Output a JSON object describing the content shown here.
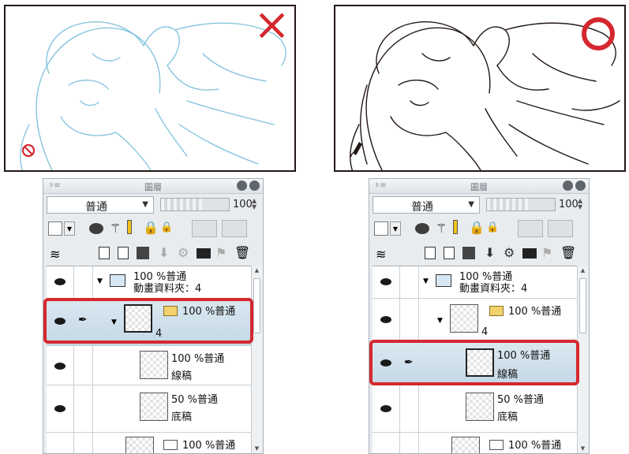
{
  "canvases": [
    {
      "marker": "×",
      "marker_name": "cross",
      "stroke_color": "#7fc2dc",
      "cursor": "prohibited-icon"
    },
    {
      "marker": "○",
      "marker_name": "circle",
      "stroke_color": "#231815",
      "cursor": "pen-icon"
    }
  ],
  "marker_color": "#d4282e",
  "panels": [
    {
      "title": "圖層",
      "blend_mode": "普通",
      "opacity": "100",
      "opacity_fill": 0.6,
      "layers": [
        {
          "line1": "100 %普通",
          "line2": "動畫資料夾：4"
        },
        {
          "line1": "100 %普通",
          "line2": "4"
        },
        {
          "line1": "100 %普通",
          "line2": "線稿"
        },
        {
          "line1": "50 %普通",
          "line2": "底稿"
        },
        {
          "line1": "100 %普通",
          "line2": ""
        }
      ]
    },
    {
      "title": "圖層",
      "blend_mode": "普通",
      "opacity": "100",
      "opacity_fill": 0.6,
      "layers": [
        {
          "line1": "100 %普通",
          "line2": "動畫資料夾：4"
        },
        {
          "line1": "100 %普通",
          "line2": "4"
        },
        {
          "line1": "100 %普通",
          "line2": "線稿"
        },
        {
          "line1": "50 %普通",
          "line2": "底稿"
        },
        {
          "line1": "100 %普通",
          "line2": ""
        }
      ]
    }
  ]
}
